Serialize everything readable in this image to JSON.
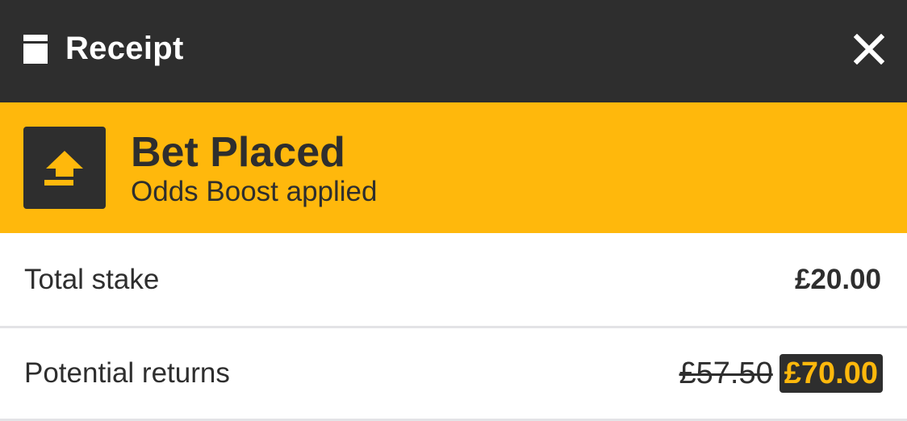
{
  "header": {
    "title": "Receipt",
    "icon": "receipt-icon",
    "close_icon": "close-icon"
  },
  "banner": {
    "icon": "odds-boost-icon",
    "title": "Bet Placed",
    "subtitle": "Odds Boost applied",
    "color": "#ffb80c"
  },
  "summary": {
    "total_stake_label": "Total stake",
    "total_stake_value": "£20.00",
    "potential_returns_label": "Potential returns",
    "potential_returns_old": "£57.50",
    "potential_returns_new": "£70.00"
  },
  "colors": {
    "dark": "#2e2e2e",
    "accent": "#ffb80c",
    "divider": "#e3e3e6"
  }
}
